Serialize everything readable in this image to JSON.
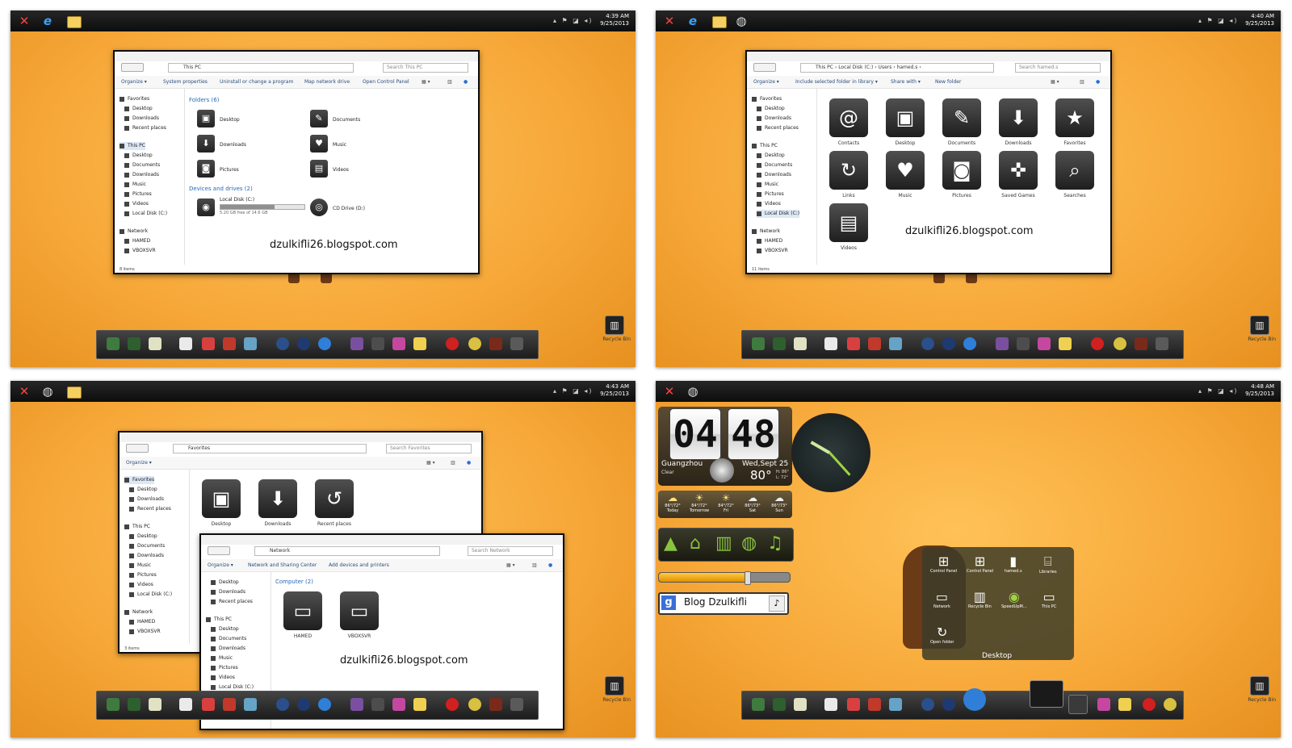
{
  "watermark": "dzulkifli26.blogspot.com",
  "screens": [
    {
      "clock_time": "4:39 AM",
      "clock_date": "9/25/2013",
      "address": "This PC",
      "search": "Search This PC",
      "commands": [
        "Organize ▾",
        "System properties",
        "Uninstall or change a program",
        "Map network drive",
        "Open Control Panel"
      ],
      "nav": [
        "Favorites",
        "Desktop",
        "Downloads",
        "Recent places",
        "This PC",
        "Desktop",
        "Documents",
        "Downloads",
        "Music",
        "Pictures",
        "Videos",
        "Local Disk (C:)",
        "Network",
        "HAMED",
        "VBOXSVR"
      ],
      "status": "8 items",
      "folders_header": "Folders (6)",
      "folders": [
        "Desktop",
        "Documents",
        "Downloads",
        "Music",
        "Pictures",
        "Videos"
      ],
      "drives_header": "Devices and drives (2)",
      "drive_c": "Local Disk (C:)",
      "drive_c_free": "5.20 GB free of 14.6 GB",
      "drive_c_used_fraction": 0.64,
      "drive_d": "CD Drive (D:)"
    },
    {
      "clock_time": "4:40 AM",
      "clock_date": "9/25/2013",
      "address": "This PC  ›  Local Disk (C:)  ›  Users  ›  hamed.s  ›",
      "search": "Search hamed.s",
      "commands": [
        "Organize ▾",
        "Include selected folder in library ▾",
        "Share with ▾",
        "New folder"
      ],
      "nav": [
        "Favorites",
        "Desktop",
        "Downloads",
        "Recent places",
        "This PC",
        "Desktop",
        "Documents",
        "Downloads",
        "Music",
        "Pictures",
        "Videos",
        "Local Disk (C:)",
        "Network",
        "HAMED",
        "VBOXSVR"
      ],
      "status": "11 items",
      "items": [
        "Contacts",
        "Desktop",
        "Documents",
        "Downloads",
        "Favorites",
        "Links",
        "Music",
        "Pictures",
        "Saved Games",
        "Searches",
        "Videos"
      ]
    },
    {
      "clock_time": "4:43 AM",
      "clock_date": "9/25/2013",
      "fav_address": "Favorites",
      "fav_search": "Search Favorites",
      "fav_commands": [
        "Organize ▾"
      ],
      "fav_nav": [
        "Favorites",
        "Desktop",
        "Downloads",
        "Recent places",
        "This PC",
        "Desktop",
        "Documents",
        "Downloads",
        "Music",
        "Pictures",
        "Videos",
        "Local Disk (C:)",
        "Network",
        "HAMED",
        "VBOXSVR"
      ],
      "fav_status": "3 items",
      "fav_items": [
        "Desktop",
        "Downloads",
        "Recent places"
      ],
      "net_address": "Network",
      "net_search": "Search Network",
      "net_commands": [
        "Organize ▾",
        "Network and Sharing Center",
        "Add devices and printers"
      ],
      "net_nav": [
        "Desktop",
        "Downloads",
        "Recent places",
        "This PC",
        "Desktop",
        "Documents",
        "Downloads",
        "Music",
        "Pictures",
        "Videos",
        "Local Disk (C:)"
      ],
      "computer_header": "Computer (2)",
      "computers": [
        "HAMED",
        "VBOXSVR"
      ]
    },
    {
      "clock_time": "4:48 AM",
      "clock_date": "9/25/2013",
      "flip_hour": "04",
      "flip_min": "48",
      "city": "Guangzhou",
      "condition": "Clear",
      "date_text": "Wed,Sept 25",
      "temp": "80°",
      "hi": "H: 86°",
      "lo": "L: 72°",
      "forecast": [
        {
          "t": "86°/72°",
          "d": "Today"
        },
        {
          "t": "84°/72°",
          "d": "Tomorrow"
        },
        {
          "t": "84°/72°",
          "d": "Fri"
        },
        {
          "t": "86°/73°",
          "d": "Sat"
        },
        {
          "t": "86°/73°",
          "d": "Sun"
        }
      ],
      "slider_fraction": 0.67,
      "search_label": "Blog Dzulkifli",
      "stack_items": [
        "Control Panel",
        "Control Panel",
        "hamed.s",
        "Libraries",
        "Network",
        "Recycle Bin",
        "SpeedUpM...",
        "This PC",
        "Open folder"
      ],
      "stack_title": "Desktop"
    }
  ],
  "recycle_label": "Recycle Bin",
  "colors": {
    "wallpaper": "#f7a93a",
    "taskbar": "#111111",
    "accent_blue": "#2668b5"
  }
}
